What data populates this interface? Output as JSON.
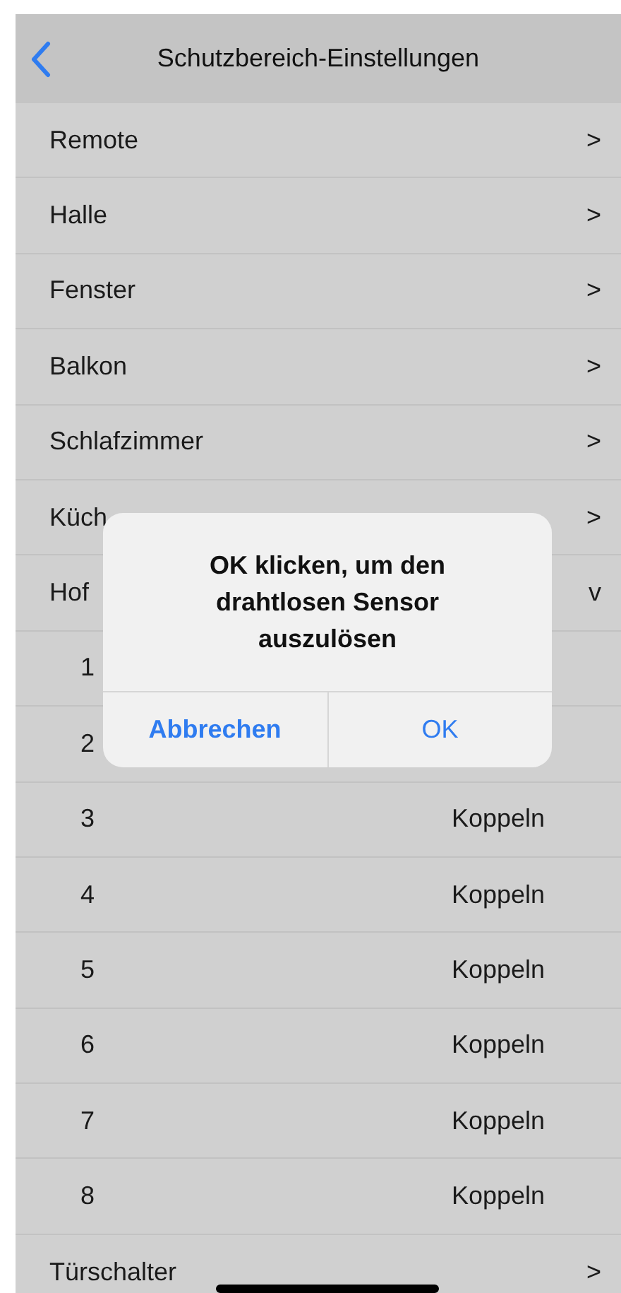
{
  "nav": {
    "title": "Schutzbereich-Einstellungen"
  },
  "items": [
    {
      "label": "Remote",
      "chevron": ">"
    },
    {
      "label": "Halle",
      "chevron": ">"
    },
    {
      "label": "Fenster",
      "chevron": ">"
    },
    {
      "label": "Balkon",
      "chevron": ">"
    },
    {
      "label": "Schlafzimmer",
      "chevron": ">"
    },
    {
      "label": "Küch",
      "chevron": ">"
    },
    {
      "label": "Hof",
      "chevron": "v",
      "children": [
        {
          "label": "1"
        },
        {
          "label": "2"
        },
        {
          "label": "3",
          "action": "Koppeln"
        },
        {
          "label": "4",
          "action": "Koppeln"
        },
        {
          "label": "5",
          "action": "Koppeln"
        },
        {
          "label": "6",
          "action": "Koppeln"
        },
        {
          "label": "7",
          "action": "Koppeln"
        },
        {
          "label": "8",
          "action": "Koppeln"
        }
      ]
    },
    {
      "label": "Türschalter",
      "chevron": ">"
    }
  ],
  "alert": {
    "message": "OK klicken, um den drahtlosen Sensor auszulösen",
    "buttons": [
      {
        "label": "Abbrechen",
        "kind": "cancel"
      },
      {
        "label": "OK",
        "kind": "default"
      }
    ]
  }
}
